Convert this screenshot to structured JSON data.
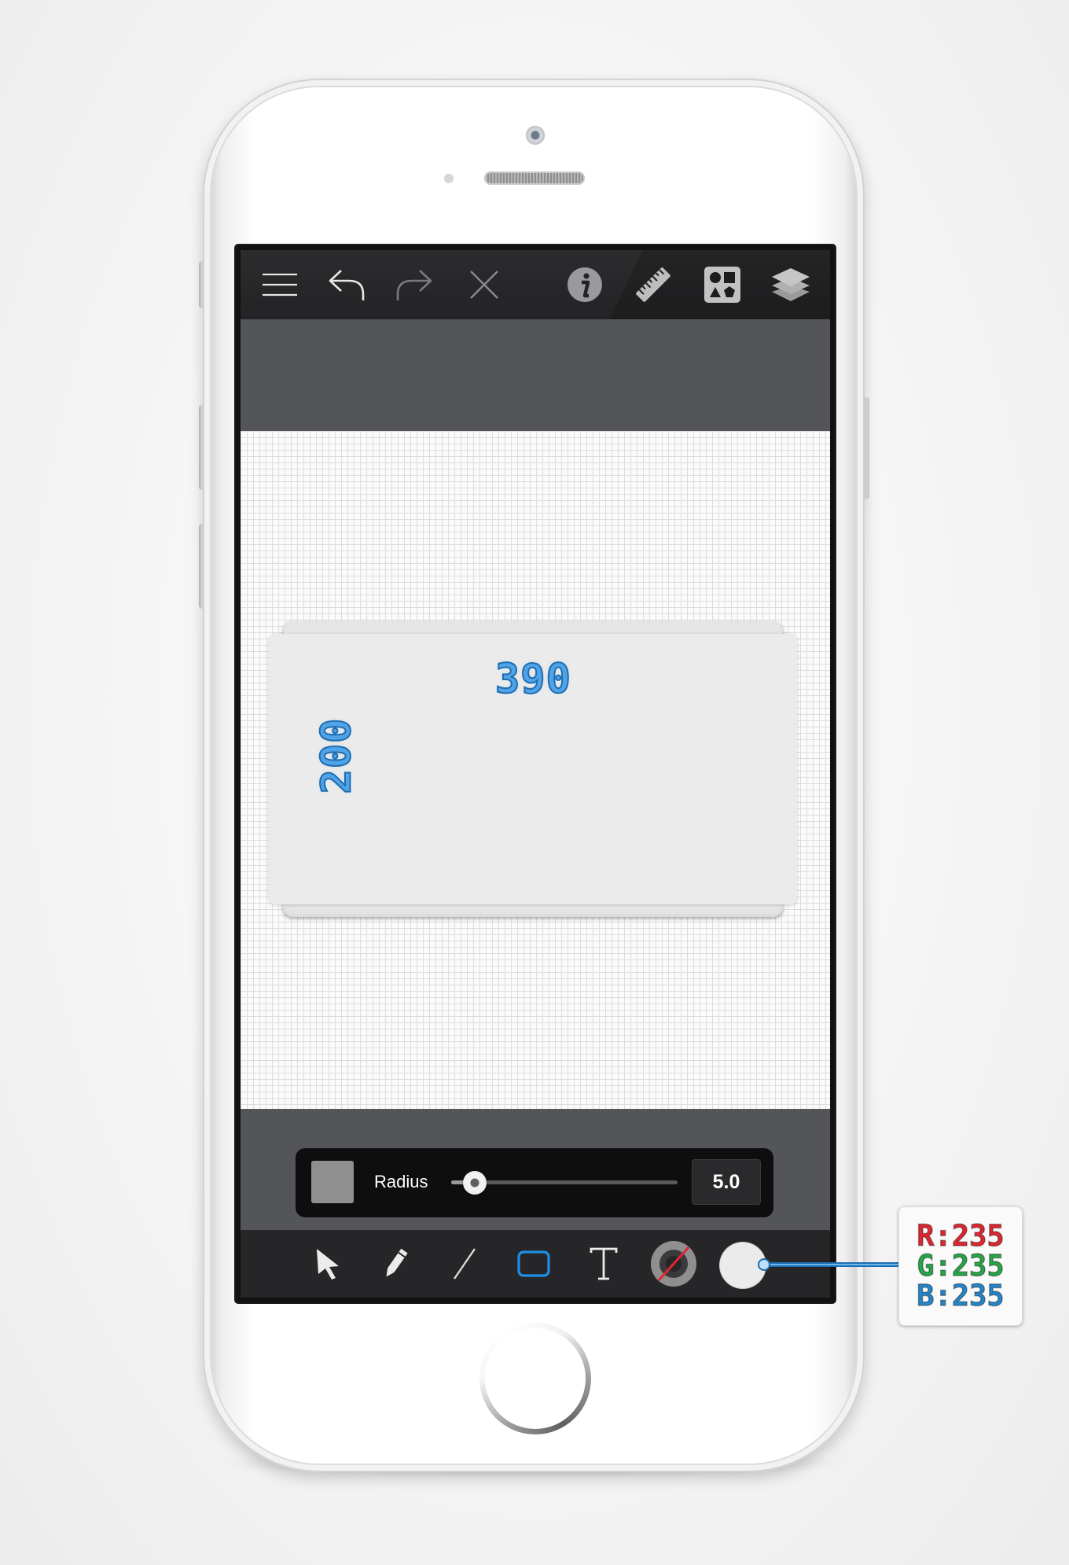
{
  "toolbar_top": {
    "icons": [
      "menu-icon",
      "undo-icon",
      "redo-icon",
      "close-icon",
      "info-icon",
      "ruler-icon",
      "shapes-icon",
      "layers-icon"
    ]
  },
  "canvas": {
    "dimension_width": "390",
    "dimension_height": "200"
  },
  "radius_panel": {
    "label": "Radius",
    "value": "5.0",
    "slider_fraction": 0.05,
    "swatch_color": "#8f8f90"
  },
  "toolbar_bottom": {
    "tools": [
      "select-arrow-icon",
      "pencil-icon",
      "line-icon",
      "rectangle-icon",
      "text-icon",
      "stroke-color-icon",
      "fill-color-icon"
    ],
    "active_tool": "rectangle-icon",
    "accent_color": "#1e8fe6"
  },
  "color_callout": {
    "r_label": "R:235",
    "g_label": "G:235",
    "b_label": "B:235",
    "r_color": "#e0262e",
    "g_color": "#27a548",
    "b_color": "#2486c9"
  }
}
